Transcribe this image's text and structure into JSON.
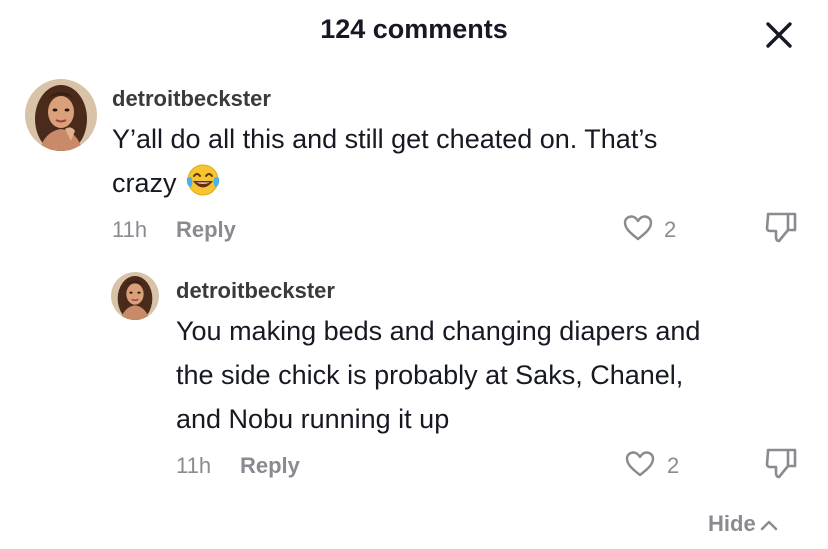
{
  "header": {
    "title": "124 comments",
    "close_icon": "close-icon"
  },
  "comments": [
    {
      "username": "detroitbeckster",
      "text_line1": "Y’all do all this and still get cheated on. That’s",
      "text_line2": "crazy",
      "emoji": "😂",
      "time": "11h",
      "reply_label": "Reply",
      "like_count": "2"
    }
  ],
  "replies": [
    {
      "username": "detroitbeckster",
      "text_line1": "You making beds and changing diapers and",
      "text_line2": "the side chick is probably at Saks, Chanel,",
      "text_line3": "and Nobu running it up",
      "time": "11h",
      "reply_label": "Reply",
      "like_count": "2"
    }
  ],
  "hide_label": "Hide",
  "colors": {
    "text": "#161823",
    "muted": "#8a8b91"
  }
}
